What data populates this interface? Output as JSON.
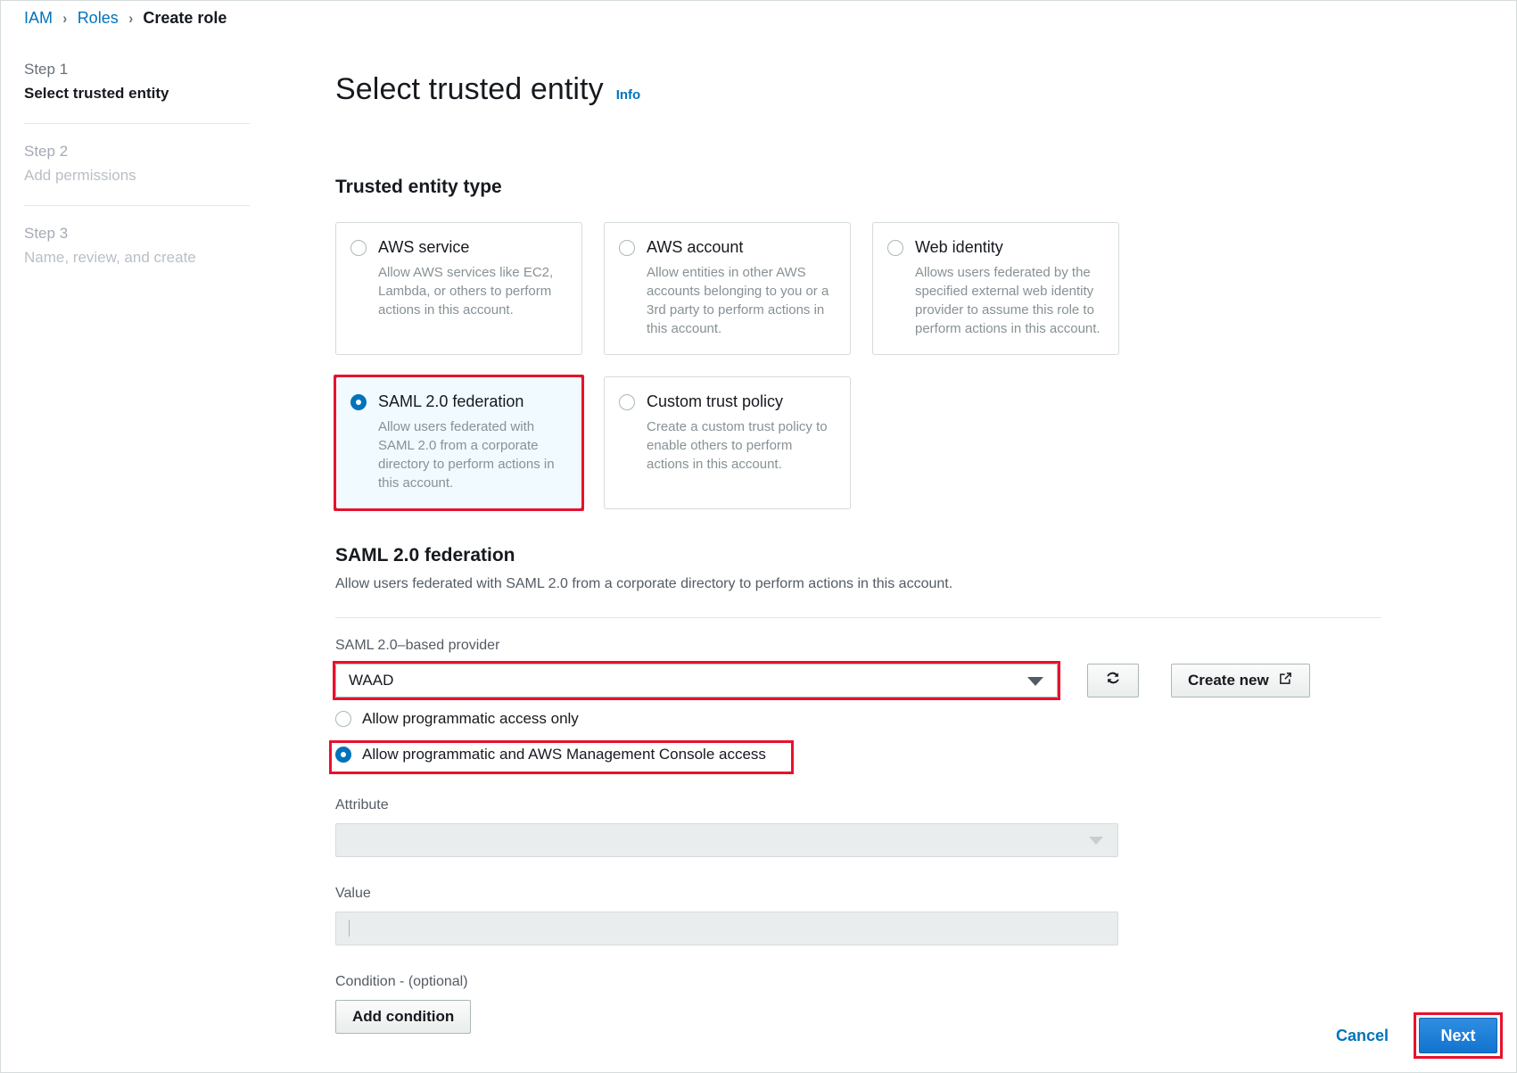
{
  "breadcrumb": {
    "items": [
      {
        "label": "IAM",
        "type": "link"
      },
      {
        "label": "Roles",
        "type": "link"
      },
      {
        "label": "Create role",
        "type": "current"
      }
    ],
    "separator": "›"
  },
  "steps": [
    {
      "num": "Step 1",
      "title": "Select trusted entity",
      "state": "active"
    },
    {
      "num": "Step 2",
      "title": "Add permissions",
      "state": "inactive"
    },
    {
      "num": "Step 3",
      "title": "Name, review, and create",
      "state": "inactive"
    }
  ],
  "header": {
    "title": "Select trusted entity",
    "info_label": "Info"
  },
  "trusted_entity_type": {
    "heading": "Trusted entity type",
    "options": [
      {
        "label": "AWS service",
        "description": "Allow AWS services like EC2, Lambda, or others to perform actions in this account.",
        "selected": false,
        "annotated": false
      },
      {
        "label": "AWS account",
        "description": "Allow entities in other AWS accounts belonging to you or a 3rd party to perform actions in this account.",
        "selected": false,
        "annotated": false
      },
      {
        "label": "Web identity",
        "description": "Allows users federated by the specified external web identity provider to assume this role to perform actions in this account.",
        "selected": false,
        "annotated": false
      },
      {
        "label": "SAML 2.0 federation",
        "description": "Allow users federated with SAML 2.0 from a corporate directory to perform actions in this account.",
        "selected": true,
        "annotated": true
      },
      {
        "label": "Custom trust policy",
        "description": "Create a custom trust policy to enable others to perform actions in this account.",
        "selected": false,
        "annotated": false
      }
    ]
  },
  "saml_section": {
    "heading": "SAML 2.0 federation",
    "description": "Allow users federated with SAML 2.0 from a corporate directory to perform actions in this account.",
    "provider_label": "SAML 2.0–based provider",
    "provider_value": "WAAD",
    "refresh_icon": "refresh-icon",
    "create_new_label": "Create new",
    "create_new_icon": "external-link-icon",
    "access_options": [
      {
        "label": "Allow programmatic access only",
        "selected": false,
        "annotated": false
      },
      {
        "label": "Allow programmatic and AWS Management Console access",
        "selected": true,
        "annotated": true
      }
    ],
    "attribute_label": "Attribute",
    "attribute_value": "",
    "value_label": "Value",
    "value_value": "",
    "condition_label": "Condition - (optional)",
    "add_condition_label": "Add condition"
  },
  "footer": {
    "cancel_label": "Cancel",
    "next_label": "Next",
    "next_annotated": true
  },
  "colors": {
    "link": "#0073bb",
    "annotation_red": "#e8112d",
    "selected_card_bg": "#f1faff",
    "primary_button": "#1273cf"
  }
}
